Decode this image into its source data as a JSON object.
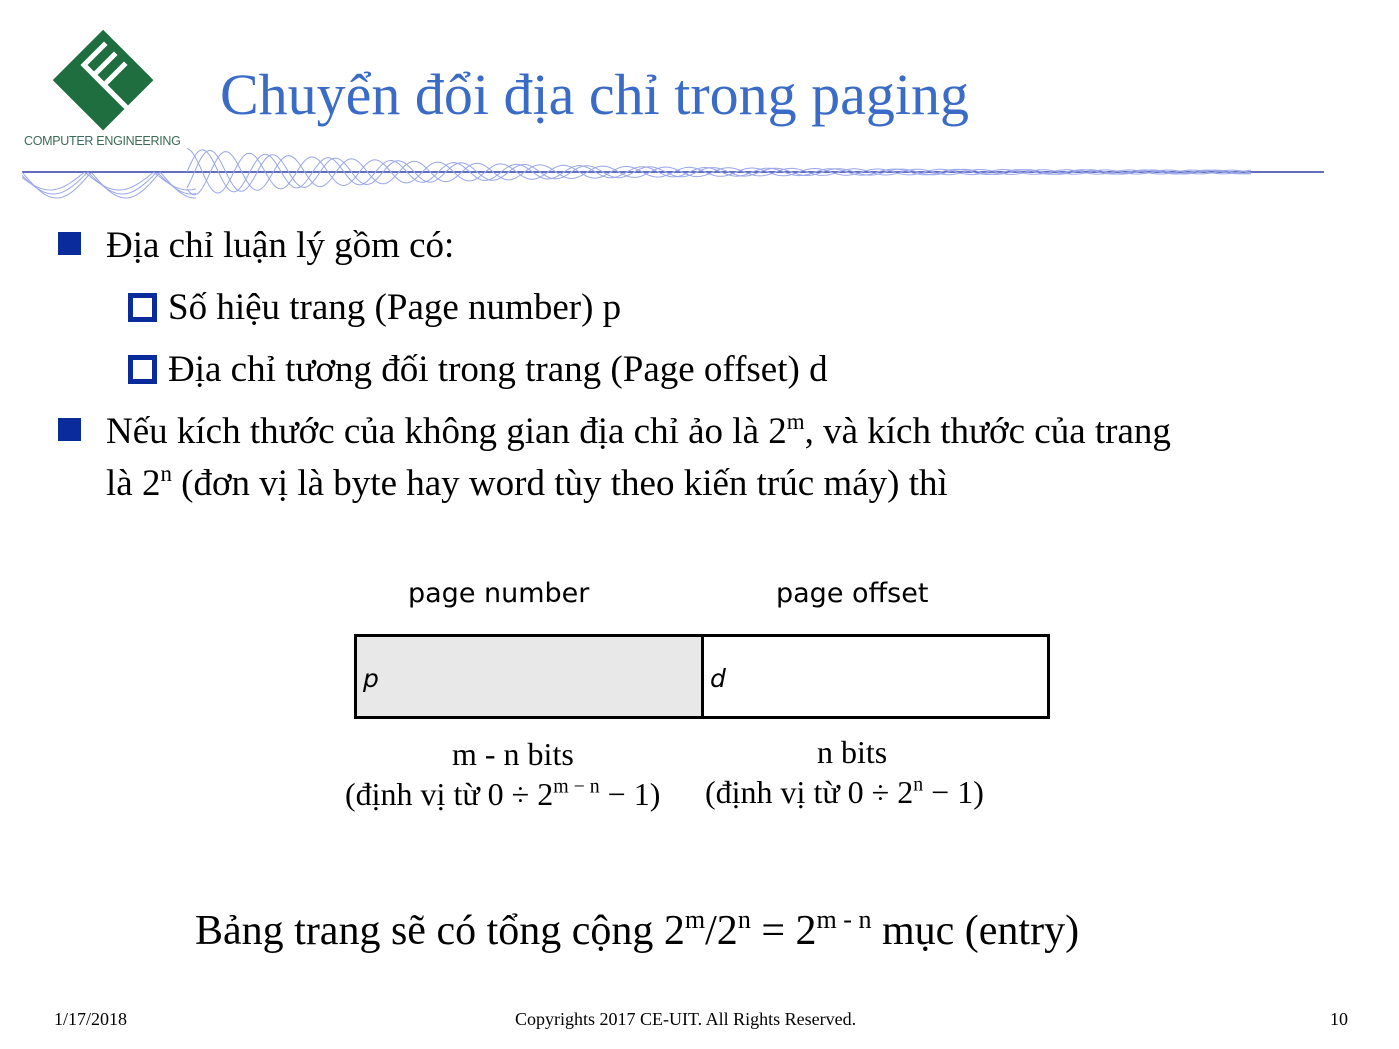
{
  "logo": {
    "text": "COMPUTER ENGINEERING",
    "colors": {
      "green": "#1f6e3f",
      "accent": "#f2c14e"
    }
  },
  "title": "Chuyển đổi địa chỉ trong paging",
  "colors": {
    "title": "#3a6bc6",
    "bullet": "#0a2c9a",
    "rule": "#2d3fa8",
    "wave": "#9aa6e8"
  },
  "bullets": [
    {
      "text": "Địa chỉ luận lý gồm có:",
      "children": [
        {
          "text": "Số hiệu trang (Page number) p"
        },
        {
          "text": "Địa chỉ tương đối trong trang (Page offset) d"
        }
      ]
    },
    {
      "line1_pre": "Nếu kích thước của không gian địa chỉ ảo là 2",
      "line1_sup": "m",
      "line1_post": ", và kích thước của trang",
      "line2_pre": "là 2",
      "line2_sup": "n",
      "line2_post": " (đơn vị là byte hay word tùy theo kiến trúc máy) thì"
    }
  ],
  "diagram": {
    "label_left": "page number",
    "label_right": "page offset",
    "field_left": "p",
    "field_right": "d",
    "left_bits": "m - n bits",
    "right_bits": "n bits",
    "left_range_pre": "(định vị từ 0 ÷ 2",
    "left_range_sup": "m − n",
    "left_range_post": " − 1)",
    "right_range_pre": "(định vị từ 0 ÷ 2",
    "right_range_sup": "n",
    "right_range_post": " − 1)"
  },
  "summary": {
    "pre": "Bảng trang sẽ có tổng cộng 2",
    "sup1": "m",
    "mid1": "/2",
    "sup2": "n",
    "mid2": " = 2",
    "sup3": "m - n",
    "post": " mục (entry)"
  },
  "footer": {
    "date": "1/17/2018",
    "copyright": "Copyrights 2017 CE-UIT. All Rights Reserved.",
    "page": "10"
  }
}
